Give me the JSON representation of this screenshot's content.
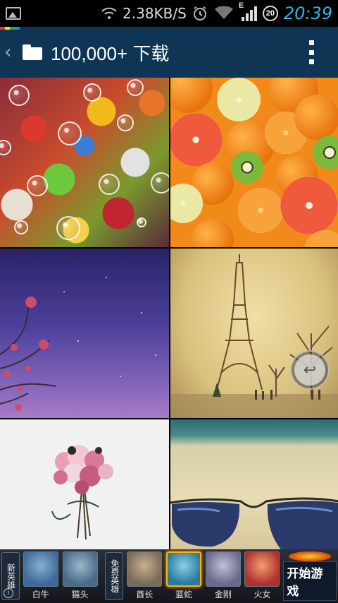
{
  "status_bar": {
    "net_speed": "2.38KB/S",
    "time": "20:39",
    "battery_badge": "20",
    "network_type": "E",
    "icons": [
      "gallery-icon",
      "wifi-icon",
      "alarm-icon",
      "signal-icon",
      "battery-icon"
    ]
  },
  "app_bar": {
    "title": "100,000+ 下载",
    "back_icon": "chevron-left-icon",
    "folder_icon": "folder-icon",
    "overflow_icon": "more-vert-icon"
  },
  "colors": {
    "app_bar": "#0e3654",
    "time": "#33b5e5",
    "accent_strip": [
      "#e53935",
      "#fdd835",
      "#43a047",
      "#1e88e5"
    ]
  },
  "wallpapers": [
    {
      "subject": "jellybeans"
    },
    {
      "subject": "citrus"
    },
    {
      "subject": "night-flower"
    },
    {
      "subject": "eiffel-tower"
    },
    {
      "subject": "bouquet"
    },
    {
      "subject": "sunglasses-beach"
    }
  ],
  "ad": {
    "left_label": "新英雄",
    "mid_label": "免费英雄",
    "heroes": [
      {
        "name": "白牛",
        "color": "#3d6a9a"
      },
      {
        "name": "猫头",
        "color": "#4a6a8a"
      },
      {
        "name": "酋长",
        "color": "#7a6a5a"
      },
      {
        "name": "蓝蛇",
        "color": "#2a7aa0"
      },
      {
        "name": "金刚",
        "color": "#6a6a8a"
      },
      {
        "name": "火女",
        "color": "#b03030"
      }
    ],
    "start_label": "开始游戏",
    "info_icon": "info-icon"
  }
}
